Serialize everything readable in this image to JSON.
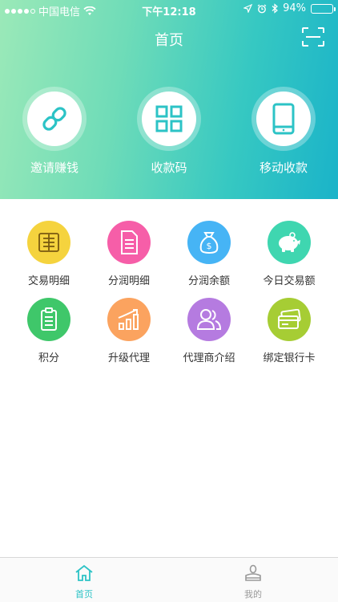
{
  "status_bar": {
    "carrier": "中国电信",
    "time": "下午12:18",
    "battery": "94%",
    "battery_level": 0.94
  },
  "nav": {
    "title": "首页"
  },
  "hero_actions": [
    {
      "label": "邀请赚钱",
      "icon": "link-icon"
    },
    {
      "label": "收款码",
      "icon": "qr-code-icon"
    },
    {
      "label": "移动收款",
      "icon": "phone-icon"
    }
  ],
  "menu": [
    {
      "label": "交易明细",
      "icon": "ledger-icon",
      "color": "#f5d33e"
    },
    {
      "label": "分润明细",
      "icon": "document-icon",
      "color": "#f65ea8"
    },
    {
      "label": "分润余额",
      "icon": "money-bag-icon",
      "color": "#46b4f5"
    },
    {
      "label": "今日交易额",
      "icon": "piggy-bank-icon",
      "color": "#3fd6b0"
    },
    {
      "label": "积分",
      "icon": "clipboard-icon",
      "color": "#3fc76a"
    },
    {
      "label": "升级代理",
      "icon": "growth-chart-icon",
      "color": "#fba35f"
    },
    {
      "label": "代理商介绍",
      "icon": "users-icon",
      "color": "#b57be0"
    },
    {
      "label": "绑定银行卡",
      "icon": "bank-card-icon",
      "color": "#a6cd34"
    }
  ],
  "tabs": [
    {
      "label": "首页",
      "active": true,
      "color": "#2cc3c6"
    },
    {
      "label": "我的",
      "active": false,
      "color": "#999999"
    }
  ],
  "colors": {
    "hero_icon": "#2cc3c6",
    "accent": "#2cc3c6"
  }
}
